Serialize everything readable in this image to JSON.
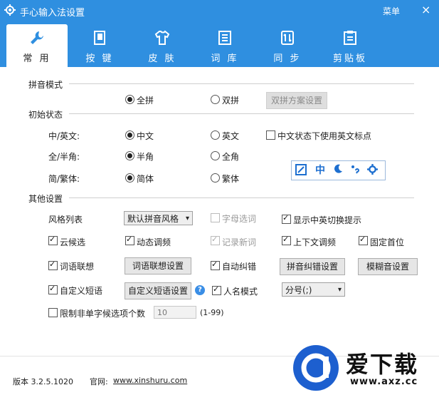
{
  "window": {
    "title": "手心输入法设置",
    "menu_label": "菜单",
    "close_symbol": "×",
    "accent": "#2f8fe0"
  },
  "tabs": [
    {
      "label": "常 用",
      "icon": "wrench-icon"
    },
    {
      "label": "按 键",
      "icon": "keyboard-icon"
    },
    {
      "label": "皮 肤",
      "icon": "tshirt-icon"
    },
    {
      "label": "词 库",
      "icon": "list-icon"
    },
    {
      "label": "同 步",
      "icon": "sync-icon"
    },
    {
      "label": "剪贴板",
      "icon": "clipboard-icon"
    }
  ],
  "pinyin_mode": {
    "section": "拼音模式",
    "full_pinyin": "全拼",
    "double_pinyin": "双拼",
    "double_scheme_button": "双拼方案设置",
    "selected": "全拼"
  },
  "initial_state": {
    "section": "初始状态",
    "cn_en_label": "中/英文:",
    "cn": "中文",
    "en": "英文",
    "cn_en_punct": "中文状态下使用英文标点",
    "half_full_label": "全/半角:",
    "half": "半角",
    "full": "全角",
    "simp_trad_label": "简/繁体:",
    "simp": "简体",
    "trad": "繁体",
    "toolbar_icons": [
      "brush-icon",
      "zhong-icon",
      "moon-icon",
      "punct-icon",
      "gear-icon"
    ],
    "toolbar_zhong_text": "中"
  },
  "other": {
    "section": "其他设置",
    "style_label": "风格列表",
    "style_value": "默认拼音风格",
    "letter_select": "字母选词",
    "show_switch_hint": "显示中英切换提示",
    "cloud_candidate": "云候选",
    "dynamic_freq": "动态调频",
    "record_new_words": "记录新词",
    "context_freq": "上下文调频",
    "fixed_first": "固定首位",
    "word_assoc": "词语联想",
    "word_assoc_btn": "词语联想设置",
    "auto_correct": "自动纠错",
    "pinyin_correct_btn": "拼音纠错设置",
    "fuzzy_btn": "模糊音设置",
    "custom_phrase": "自定义短语",
    "custom_phrase_btn": "自定义短语设置",
    "help_symbol": "?",
    "name_mode": "人名模式",
    "name_mode_value": "分号(;)",
    "limit_label": "限制非单字候选项个数",
    "limit_value": "10",
    "limit_range": "(1-99)"
  },
  "footer": {
    "version": "版本 3.2.5.1020",
    "site_label": "官网:",
    "site_link": "www.xinshuru.com"
  },
  "watermark": {
    "text": "爱下载",
    "url": "www.axz.cc"
  }
}
